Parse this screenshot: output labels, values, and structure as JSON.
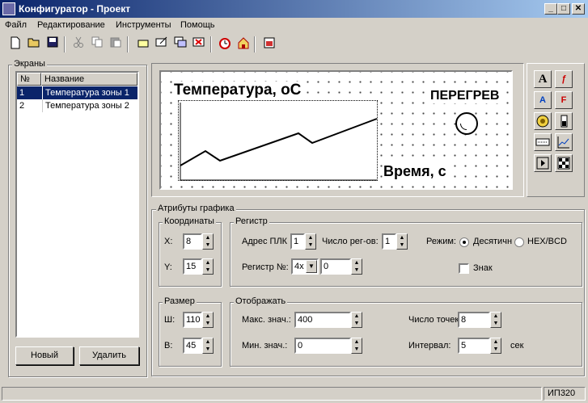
{
  "window": {
    "title": "Конфигуратор - Проект",
    "min_glyph": "_",
    "max_glyph": "□",
    "close_glyph": "✕"
  },
  "menu": [
    "Файл",
    "Редактирование",
    "Инструменты",
    "Помощь"
  ],
  "toolbar_icons": [
    "new-file-icon",
    "open-folder-icon",
    "save-icon",
    "cut-icon",
    "copy-icon",
    "paste-icon",
    "rectangle-icon",
    "edit-screen-icon",
    "screens-icon",
    "delete-screen-icon",
    "alarm-clock-icon",
    "home-icon",
    "export-icon"
  ],
  "screens": {
    "group_label": "Экраны",
    "columns": [
      "№",
      "Название"
    ],
    "rows": [
      {
        "num": "1",
        "name": "Температура зоны 1"
      },
      {
        "num": "2",
        "name": "Температура зоны 2"
      }
    ],
    "selected_index": 0,
    "new_button": "Новый",
    "delete_button": "Удалить"
  },
  "preview": {
    "title": "Температура, оС",
    "alarm_text": "ПЕРЕГРЕВ",
    "x_label": "Время, с"
  },
  "palette_icons": [
    "text-tool-icon",
    "font-tool-icon",
    "rotate-text-icon",
    "font-color-icon",
    "lamp-tool-icon",
    "bar-indicator-icon",
    "numeric-field-icon",
    "graph-tool-icon",
    "button-tool-icon",
    "bitmap-tool-icon"
  ],
  "attributes": {
    "group_label": "Атрибуты графика",
    "coords": {
      "label": "Координаты",
      "x_label": "X:",
      "x_value": "8",
      "y_label": "Y:",
      "y_value": "15"
    },
    "register": {
      "label": "Регистр",
      "plc_addr_label": "Адрес ПЛК",
      "plc_addr_value": "1",
      "reg_count_label": "Число рег-ов:",
      "reg_count_value": "1",
      "reg_num_label": "Регистр №:",
      "reg_type_value": "4x",
      "reg_num_value": "0",
      "mode_label": "Режим:",
      "mode_decimal": "Десятичн",
      "mode_hex": "HEX/BCD",
      "sign_label": "Знак"
    },
    "size": {
      "label": "Размер",
      "w_label": "Ш:",
      "w_value": "110",
      "h_label": "В:",
      "h_value": "45"
    },
    "display": {
      "label": "Отображать",
      "max_label": "Макс. знач.:",
      "max_value": "400",
      "min_label": "Мин. знач.:",
      "min_value": "0",
      "points_label": "Число точек",
      "points_value": "8",
      "interval_label": "Интервал:",
      "interval_value": "5",
      "interval_unit": "сек"
    }
  },
  "status": {
    "device": "ИП320"
  }
}
